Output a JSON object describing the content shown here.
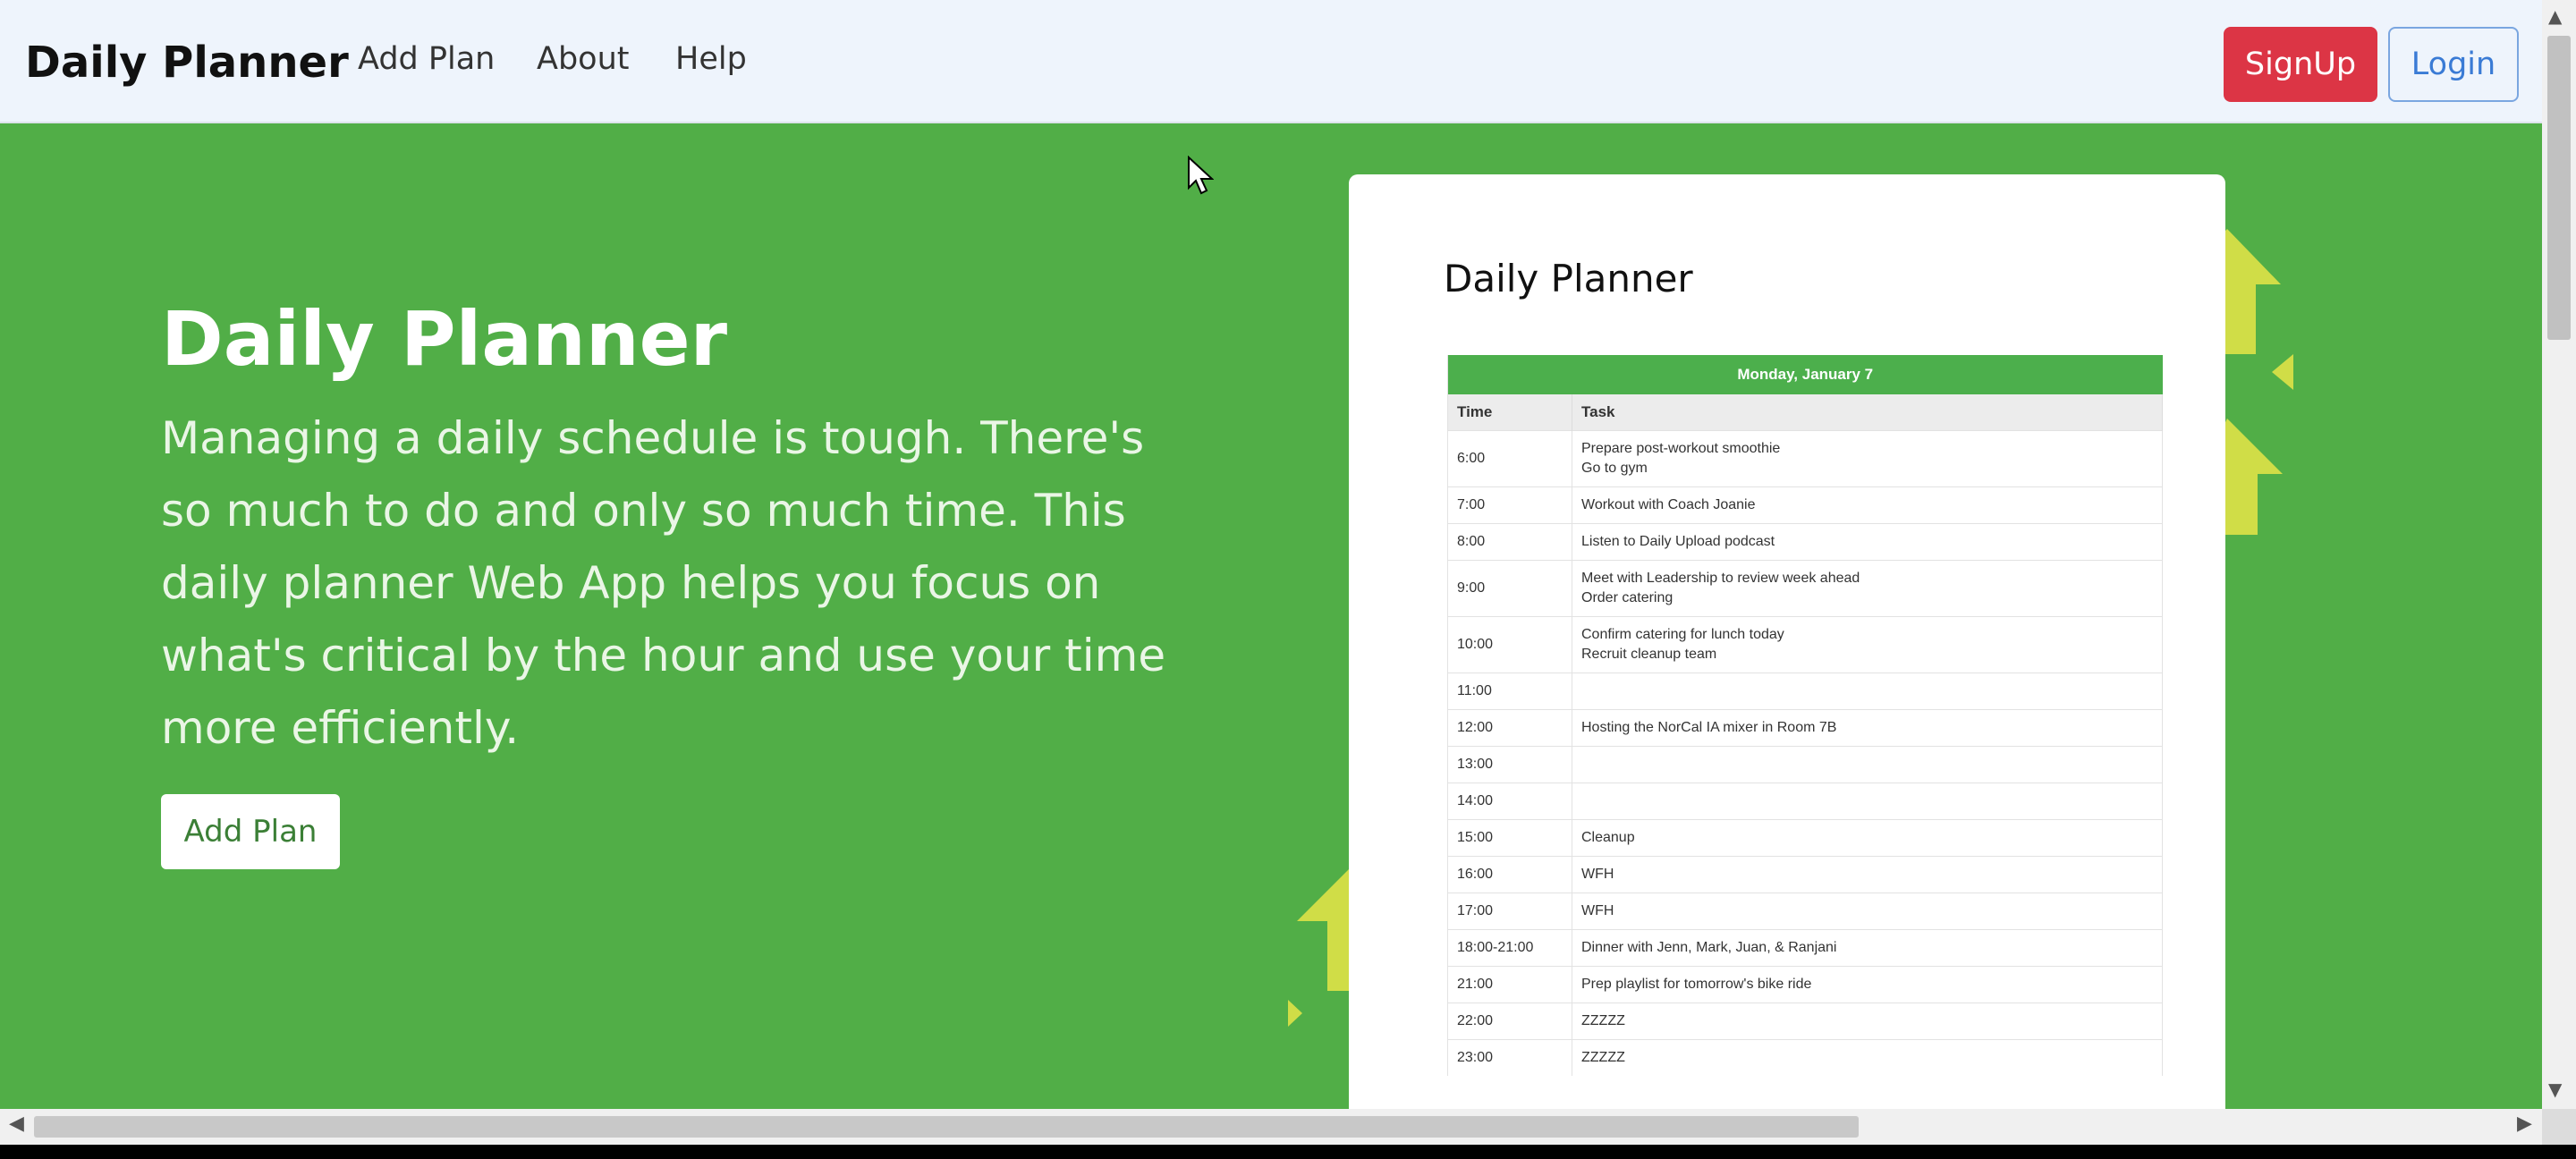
{
  "navbar": {
    "brand": "Daily Planner",
    "links": [
      "Add Plan",
      "About",
      "Help"
    ],
    "signup_label": "SignUp",
    "login_label": "Login"
  },
  "hero": {
    "title": "Daily Planner",
    "description": "Managing a daily schedule is tough. There's so much to do and only so much time. This daily planner Web App helps you focus on what's critical by the hour and use your time more efficiently.",
    "cta_label": "Add Plan"
  },
  "planner_card": {
    "title": "Daily Planner",
    "date": "Monday, January 7",
    "columns": [
      "Time",
      "Task"
    ],
    "rows": [
      {
        "time": "6:00",
        "task": [
          "Prepare post-workout smoothie",
          "Go to gym"
        ]
      },
      {
        "time": "7:00",
        "task": [
          "Workout with Coach Joanie"
        ]
      },
      {
        "time": "8:00",
        "task": [
          "Listen to Daily Upload podcast"
        ]
      },
      {
        "time": "9:00",
        "task": [
          "Meet with Leadership to review week ahead",
          "Order catering"
        ]
      },
      {
        "time": "10:00",
        "task": [
          "Confirm catering for lunch today",
          "Recruit cleanup team"
        ]
      },
      {
        "time": "11:00",
        "task": []
      },
      {
        "time": "12:00",
        "task": [
          "Hosting the NorCal IA mixer in Room 7B"
        ]
      },
      {
        "time": "13:00",
        "task": []
      },
      {
        "time": "14:00",
        "task": []
      },
      {
        "time": "15:00",
        "task": [
          "Cleanup"
        ]
      },
      {
        "time": "16:00",
        "task": [
          "WFH"
        ]
      },
      {
        "time": "17:00",
        "task": [
          "WFH"
        ]
      },
      {
        "time": "18:00-21:00",
        "task": [
          "Dinner with Jenn, Mark, Juan, & Ranjani"
        ]
      },
      {
        "time": "21:00",
        "task": [
          "Prep playlist for tomorrow's bike ride"
        ]
      },
      {
        "time": "22:00",
        "task": [
          "ZZZZZ"
        ]
      },
      {
        "time": "23:00",
        "task": [
          "ZZZZZ"
        ]
      }
    ]
  },
  "colors": {
    "hero_bg": "#51ae47",
    "navbar_bg": "#eef4fc",
    "signup_bg": "#dc3545",
    "login_border": "#7aa6e0",
    "arrow_accent": "#d0dd47",
    "table_header": "#4caf4c"
  },
  "icons": {
    "cursor": "mouse-pointer-icon",
    "scroll_up": "chevron-up-icon",
    "scroll_down": "chevron-down-icon",
    "scroll_left": "chevron-left-icon",
    "scroll_right": "chevron-right-icon",
    "decor": "up-arrow-icon"
  }
}
